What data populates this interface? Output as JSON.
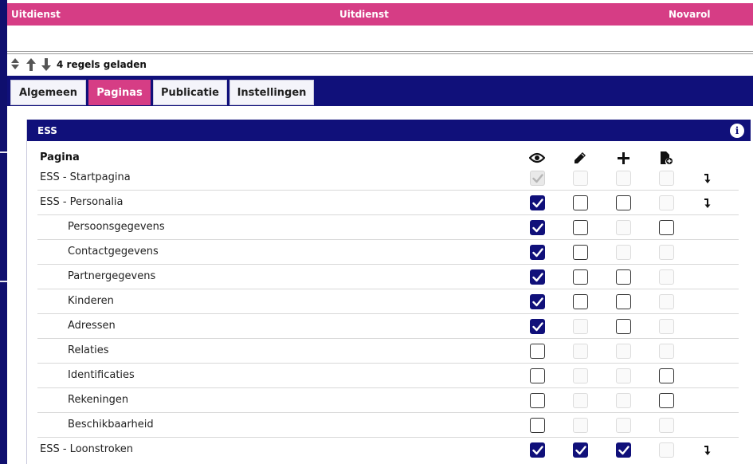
{
  "header": {
    "left_text": "Uitdienst",
    "center_text": "Uitdienst",
    "right_text": "Novarol"
  },
  "toolbar": {
    "status": "4 regels geladen",
    "icons": [
      "sort-toggle-icon",
      "arrow-up-icon",
      "arrow-down-icon"
    ]
  },
  "tabs": [
    {
      "label": "Algemeen",
      "active": false
    },
    {
      "label": "Paginas",
      "active": true
    },
    {
      "label": "Publicatie",
      "active": false
    },
    {
      "label": "Instellingen",
      "active": false
    }
  ],
  "panel": {
    "title": "ESS",
    "info_icon": "info-icon",
    "column_label": "Pagina",
    "columns": [
      "view-icon",
      "edit-icon",
      "add-icon",
      "document-add-icon"
    ]
  },
  "colors": {
    "brand_pink": "#d63d85",
    "brand_navy": "#10107a"
  },
  "rows": [
    {
      "label": "ESS - Startpagina",
      "indent": false,
      "states": [
        "dison",
        "dis",
        "dis",
        "dis"
      ],
      "arrow": true
    },
    {
      "label": "ESS - Personalia",
      "indent": false,
      "states": [
        "on",
        "off",
        "off",
        "dis"
      ],
      "arrow": true
    },
    {
      "label": "Persoonsgegevens",
      "indent": true,
      "states": [
        "on",
        "off",
        "dis",
        "off"
      ],
      "arrow": false
    },
    {
      "label": "Contactgegevens",
      "indent": true,
      "states": [
        "on",
        "off",
        "dis",
        "dis"
      ],
      "arrow": false
    },
    {
      "label": "Partnergegevens",
      "indent": true,
      "states": [
        "on",
        "off",
        "off",
        "dis"
      ],
      "arrow": false
    },
    {
      "label": "Kinderen",
      "indent": true,
      "states": [
        "on",
        "off",
        "off",
        "dis"
      ],
      "arrow": false
    },
    {
      "label": "Adressen",
      "indent": true,
      "states": [
        "on",
        "dis",
        "off",
        "dis"
      ],
      "arrow": false
    },
    {
      "label": "Relaties",
      "indent": true,
      "states": [
        "off",
        "dis",
        "dis",
        "dis"
      ],
      "arrow": false
    },
    {
      "label": "Identificaties",
      "indent": true,
      "states": [
        "off",
        "dis",
        "dis",
        "off"
      ],
      "arrow": false
    },
    {
      "label": "Rekeningen",
      "indent": true,
      "states": [
        "off",
        "dis",
        "dis",
        "off"
      ],
      "arrow": false
    },
    {
      "label": "Beschikbaarheid",
      "indent": true,
      "states": [
        "off",
        "dis",
        "dis",
        "dis"
      ],
      "arrow": false
    },
    {
      "label": "ESS - Loonstroken",
      "indent": false,
      "states": [
        "on",
        "on",
        "on",
        "dis"
      ],
      "arrow": true
    }
  ]
}
